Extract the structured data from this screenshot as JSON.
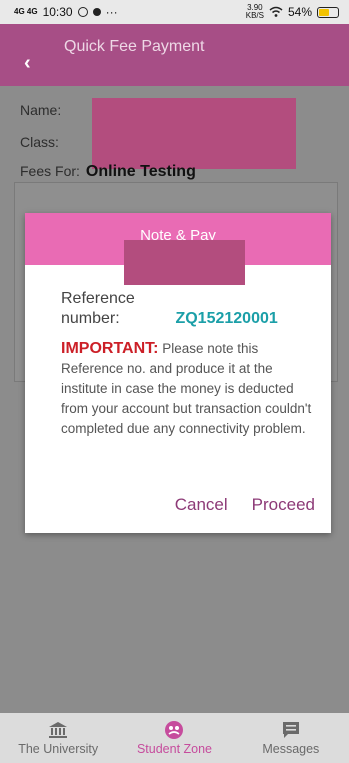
{
  "status_bar": {
    "signal": "4G 4G",
    "time": "10:30",
    "overflow": "···",
    "network_speed": "3.90",
    "network_speed_unit": "KB/S",
    "battery": "54%"
  },
  "header": {
    "back_icon": "chevron-left-icon",
    "title": "Quick Fee Payment"
  },
  "form": {
    "name_label": "Name:",
    "class_label": "Class:",
    "fees_for_label": "Fees For:",
    "fees_for_value": "Online Testing"
  },
  "dialog": {
    "title": "Note & Pay",
    "reference_label": "Reference number:",
    "reference_number": "ZQ152120001",
    "important_label": "IMPORTANT:",
    "message": "Please note this Reference no. and produce it at the institute in case the money is deducted from your account but transaction couldn't completed due any connectivity problem.",
    "cancel_label": "Cancel",
    "proceed_label": "Proceed"
  },
  "bottom_nav": {
    "items": [
      {
        "label": "The University",
        "icon": "bank-icon",
        "active": false
      },
      {
        "label": "Student Zone",
        "icon": "student-zone-icon",
        "active": true
      },
      {
        "label": "Messages",
        "icon": "message-icon",
        "active": false
      }
    ]
  },
  "colors": {
    "header": "#a74e86",
    "dialog_header": "#e96bb4",
    "reference_number": "#1b9fa8",
    "important": "#cc1f27",
    "dialog_buttons": "#8d3a77",
    "active_nav": "#c64c9d"
  }
}
